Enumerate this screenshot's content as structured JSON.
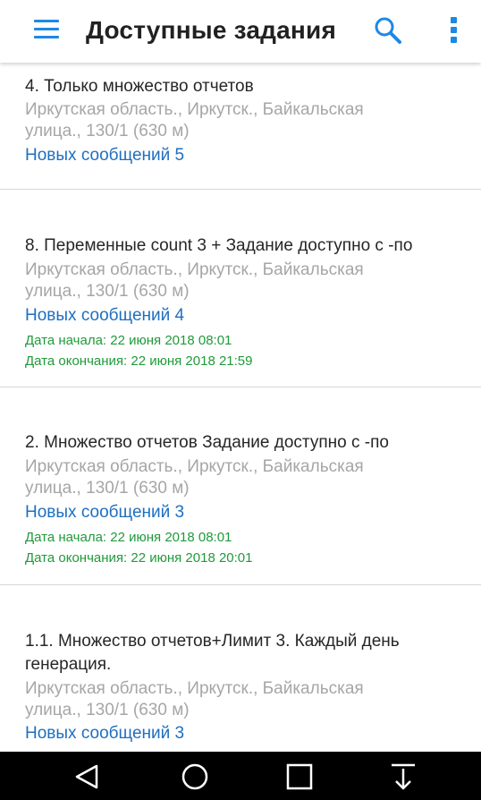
{
  "app_bar": {
    "title": "Доступные задания",
    "icons": {
      "menu": "hamburger-menu-icon",
      "search": "search-icon",
      "more": "more-vert-icon"
    },
    "accent_color": "#1e88e5"
  },
  "tasks": [
    {
      "title_lines": [
        "4. Только множество отчетов"
      ],
      "address_lines": [
        "Иркутская область., Иркутск., Байкальская",
        "улица., 130/1 (630 м)"
      ],
      "messages": "Новых сообщений 5",
      "start_date": "",
      "end_date": ""
    },
    {
      "title_lines": [
        "8. Переменные count 3 + Задание доступно с -по"
      ],
      "address_lines": [
        "Иркутская область., Иркутск., Байкальская",
        "улица., 130/1 (630 м)"
      ],
      "messages": "Новых сообщений 4",
      "start_date": "Дата начала: 22 июня 2018 08:01",
      "end_date": "Дата окончания: 22 июня 2018 21:59"
    },
    {
      "title_lines": [
        "2. Множество отчетов Задание доступно с -по"
      ],
      "address_lines": [
        "Иркутская область., Иркутск., Байкальская",
        "улица., 130/1 (630 м)"
      ],
      "messages": "Новых сообщений 3",
      "start_date": "Дата начала: 22 июня 2018 08:01",
      "end_date": "Дата окончания: 22 июня 2018 20:01"
    },
    {
      "title_lines": [
        "1.1. Множество отчетов+Лимит 3. Каждый день",
        "генерация."
      ],
      "address_lines": [
        "Иркутская область., Иркутск., Байкальская",
        "улица., 130/1 (630 м)"
      ],
      "messages": "Новых сообщений 3",
      "start_date": "",
      "end_date": ""
    }
  ],
  "colors": {
    "title": "#262626",
    "address": "#a6a6a6",
    "messages": "#1e6fc0",
    "dates": "#1f9a3a"
  },
  "nav_bar": {
    "icons": [
      "back-triangle-icon",
      "home-circle-icon",
      "recents-square-icon",
      "notification-pull-icon"
    ]
  }
}
